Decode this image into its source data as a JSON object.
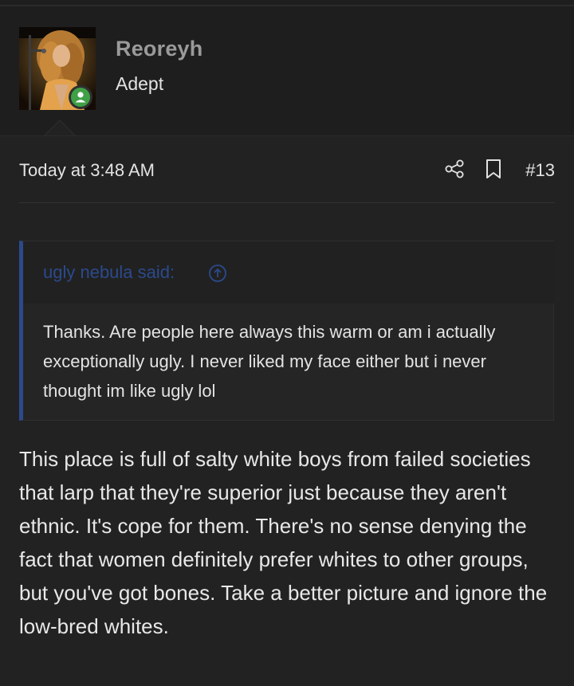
{
  "user": {
    "name": "Reoreyh",
    "title": "Adept",
    "avatar_icon": "user-avatar-photo",
    "status_icon": "online-user-icon",
    "status_color": "#3fa046"
  },
  "post": {
    "date": "Today at 3:48 AM",
    "number": "#13",
    "share_icon": "share-icon",
    "bookmark_icon": "bookmark-icon"
  },
  "quote": {
    "author_label": "ugly nebula said:",
    "jump_icon": "arrow-up-circle-icon",
    "text": "Thanks. Are people here always this warm or am i actually exceptionally ugly. I never liked my face either but i never thought im like ugly lol",
    "accent_color": "#2b4a8c"
  },
  "message": {
    "text": "This place is full of salty white boys from failed societies that larp that they're superior just because they aren't ethnic. It's cope for them. There's no sense denying the fact that women definitely prefer whites to other groups, but you've got bones. Take a better picture and ignore the low-bred whites."
  }
}
